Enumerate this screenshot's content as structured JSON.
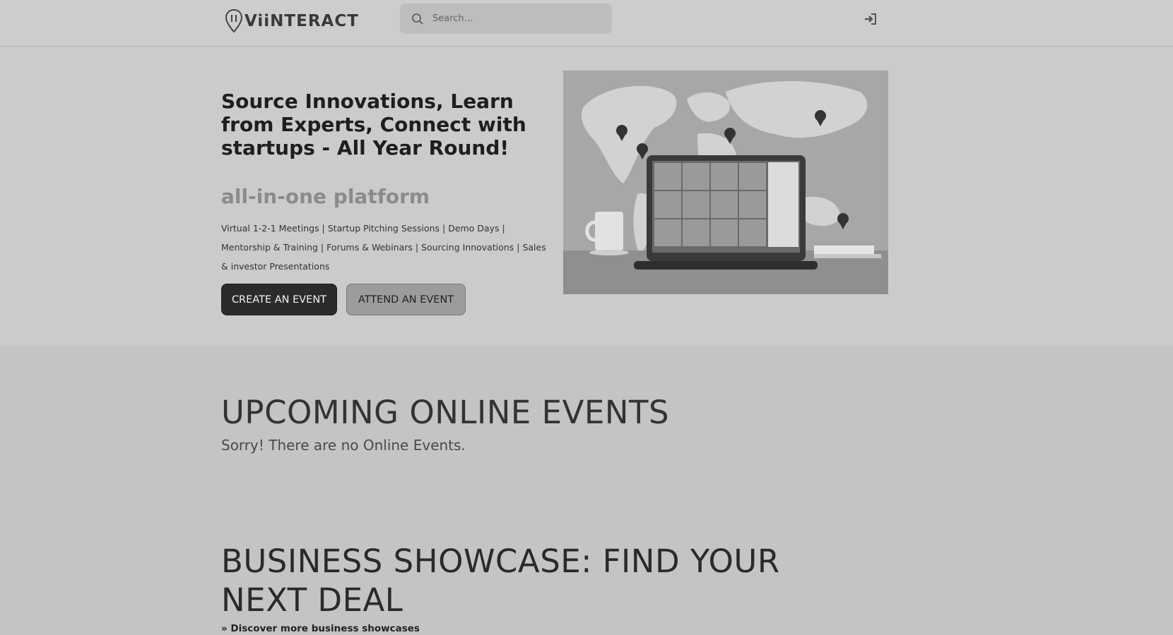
{
  "header": {
    "logo_text": "ViiNTERACT",
    "search_placeholder": "Search..."
  },
  "hero": {
    "title": "Source Innovations, Learn from Experts, Connect with startups - All Year Round!",
    "subtitle": "all-in-one platform",
    "description": "Virtual 1-2-1 Meetings | Startup Pitching Sessions | Demo Days | Mentorship & Training | Forums & Webinars  | Sourcing Innovations | Sales & investor Presentations",
    "create_button": "CREATE AN EVENT",
    "attend_button": "ATTEND AN EVENT"
  },
  "events": {
    "heading": "UPCOMING ONLINE EVENTS",
    "empty_message": "Sorry! There are no Online Events."
  },
  "showcase": {
    "heading": "BUSINESS SHOWCASE: FIND YOUR NEXT DEAL",
    "link": "» Discover more business showcases"
  },
  "icons": {
    "search": "search-icon",
    "login": "login-icon",
    "logo": "location-pin-icon"
  }
}
